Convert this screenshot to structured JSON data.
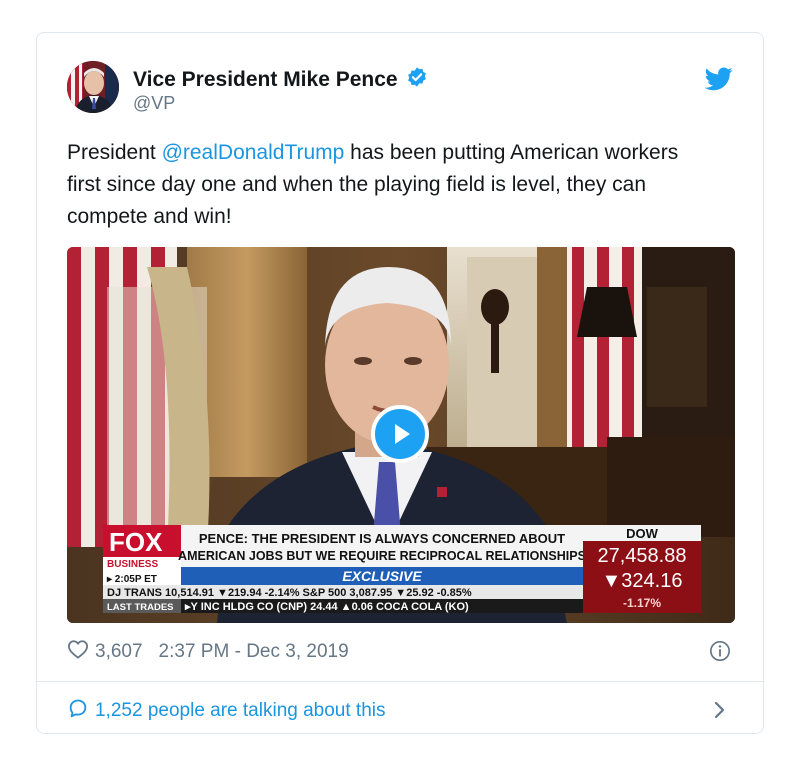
{
  "author": {
    "name": "Vice President Mike Pence",
    "handle": "@VP"
  },
  "tweet": {
    "text_before": "President ",
    "mention": "@realDonaldTrump",
    "text_after": " has been putting American workers first since day one and when the playing field is level, they can compete and win!"
  },
  "video": {
    "network_logo": "FOX",
    "network_sub": "BUSINESS",
    "time": "▸ 2:05P ET",
    "headline_line1": "PENCE: THE PRESIDENT IS ALWAYS CONCERNED ABOUT",
    "headline_line2": "AMERICAN JOBS BUT WE REQUIRE RECIPROCAL RELATIONSHIPS",
    "banner": "EXCLUSIVE",
    "ticker_row1": "DJ TRANS 10,514.91 ▼219.94 -2.14% S&P 500 3,087.95 ▼25.92 -0.85%",
    "ticker_row2_label": "LAST TRADES",
    "ticker_row2": "▸Y INC HLDG CO (CNP) 24.44 ▲0.06   COCA COLA (KO)",
    "dow_label": "DOW",
    "dow_value": "27,458.88",
    "dow_change": "▼324.16",
    "dow_pct": "-1.17%"
  },
  "footer": {
    "likes": "3,607",
    "timestamp": "2:37 PM - Dec 3, 2019",
    "talking": "1,252 people are talking about this"
  },
  "colors": {
    "accent": "#1da1f2",
    "link": "#1b95e0",
    "muted": "#657786",
    "fox_red": "#c8102e",
    "banner_blue": "#1f5fb8"
  },
  "icons": [
    "verified-badge-icon",
    "twitter-bird-icon",
    "heart-icon",
    "info-icon",
    "reply-bubble-icon",
    "chevron-right-icon",
    "play-icon"
  ]
}
